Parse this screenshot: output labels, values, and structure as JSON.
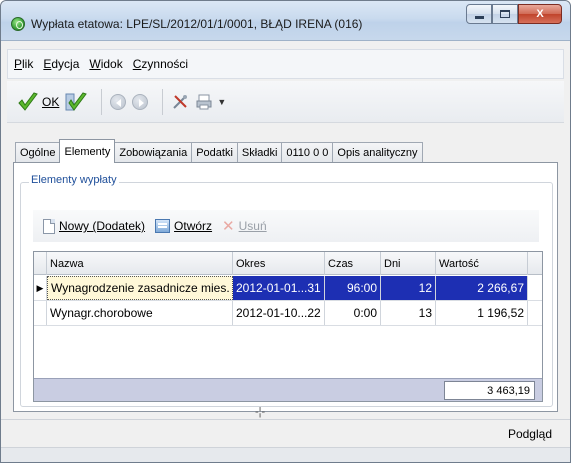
{
  "window": {
    "title": "Wypłata etatowa: LPE/SL/2012/01/1/0001, BŁĄD IRENA (016)",
    "close_glyph": "X"
  },
  "menu": [
    {
      "pre": "",
      "ul": "P",
      "post": "lik"
    },
    {
      "pre": "",
      "ul": "E",
      "post": "dycja"
    },
    {
      "pre": "",
      "ul": "W",
      "post": "idok"
    },
    {
      "pre": "",
      "ul": "C",
      "post": "zynności"
    }
  ],
  "toolbar": {
    "ok_label": "OK"
  },
  "tabs": [
    "Ogólne",
    "Elementy",
    "Zobowiązania",
    "Podatki",
    "Składki",
    "0110 0 0",
    "Opis analityczny"
  ],
  "active_tab": "Elementy",
  "group": {
    "legend": "Elementy wypłaty"
  },
  "subtoolbar": {
    "new_label": "Nowy (Dodatek)",
    "open_label": "Otwórz",
    "delete_label": "Usuń"
  },
  "grid": {
    "columns": [
      "Nazwa",
      "Okres",
      "Czas",
      "Dni",
      "Wartość"
    ],
    "rows": [
      {
        "indicator": "▶",
        "nazwa": "Wynagrodzenie zasadnicze mies.",
        "okres": "2012-01-01...31",
        "czas": "96:00",
        "dni": "12",
        "wartosc": "2 266,67",
        "selected": true
      },
      {
        "indicator": "",
        "nazwa": "Wynagr.chorobowe",
        "okres": "2012-01-10...22",
        "czas": "0:00",
        "dni": "13",
        "wartosc": "1 196,52",
        "selected": false
      }
    ],
    "total": "3 463,19"
  },
  "status": {
    "preview_label": "Podgląd",
    "splitter_glyph": "-¦-"
  },
  "colors": {
    "selection": "#1d2fb3",
    "accent_green": "#3da33a",
    "legend_blue": "#1f4f9a"
  }
}
